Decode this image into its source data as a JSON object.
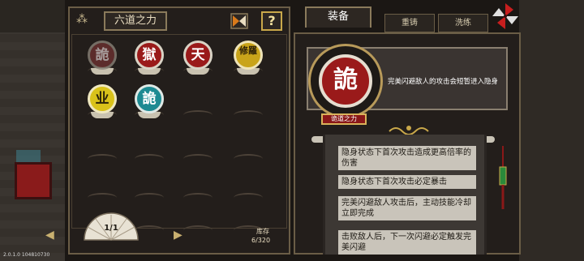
{
  "version": "2.0.1.0 104810730",
  "inventory": {
    "category_tab": "六道之力",
    "help_label": "?",
    "page_indicator": "1/1",
    "stock_label": "库存",
    "stock_value": "6/320",
    "slots": [
      {
        "char": "詭",
        "style": "dim"
      },
      {
        "char": "獄",
        "style": "red"
      },
      {
        "char": "天",
        "style": "red"
      },
      {
        "char": "修羅",
        "style": "gold"
      },
      {
        "char": "业",
        "style": "yellow"
      },
      {
        "char": "詭",
        "style": "teal"
      }
    ]
  },
  "tabs": {
    "equip": "装备",
    "recast": "重铸",
    "refine": "洗练"
  },
  "detail": {
    "rune_char": "詭",
    "description": "完美闪避敌人的攻击会短暂进入隐身",
    "name": "诡道之力",
    "effects": [
      "隐身状态下首次攻击造成更高倍率的伤害",
      "隐身状态下首次攻击必定暴击",
      "完美闪避敌人攻击后，主动技能冷却立即完成",
      "击败敌人后，下一次闪避必定触发完美闪避"
    ]
  },
  "colors": {
    "accent_gold": "#c9a84a",
    "rune_red": "#9a1a1a",
    "panel_bg": "#231e1b"
  }
}
